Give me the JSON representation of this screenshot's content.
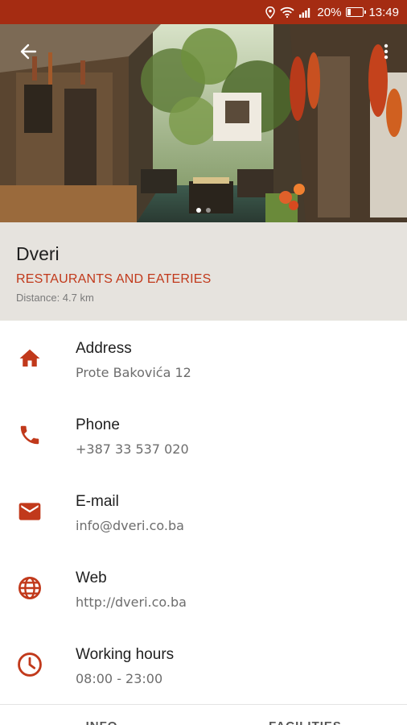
{
  "status_bar": {
    "battery_percent": "20%",
    "battery_level": 0.2,
    "time": "13:49",
    "icons": [
      "location-icon",
      "wifi-icon",
      "signal-icon",
      "battery-icon"
    ]
  },
  "hero": {
    "back_icon": "arrow-back-icon",
    "menu_icon": "more-vert-icon",
    "pages": 2,
    "active_page": 1
  },
  "place": {
    "name": "Dveri",
    "category": "RESTAURANTS AND EATERIES",
    "distance": "Distance: 4.7 km"
  },
  "accent_color": "#c1391b",
  "status_color": "#a52c12",
  "info": [
    {
      "icon": "home-icon",
      "label": "Address",
      "value": "Prote Bakovića 12"
    },
    {
      "icon": "phone-icon",
      "label": "Phone",
      "value": "+387 33 537 020"
    },
    {
      "icon": "email-icon",
      "label": "E-mail",
      "value": "info@dveri.co.ba"
    },
    {
      "icon": "globe-icon",
      "label": "Web",
      "value": "http://dveri.co.ba"
    },
    {
      "icon": "clock-icon",
      "label": "Working hours",
      "value": "08:00 - 23:00"
    }
  ],
  "tabs": [
    "INFO",
    "FACILITIES"
  ]
}
